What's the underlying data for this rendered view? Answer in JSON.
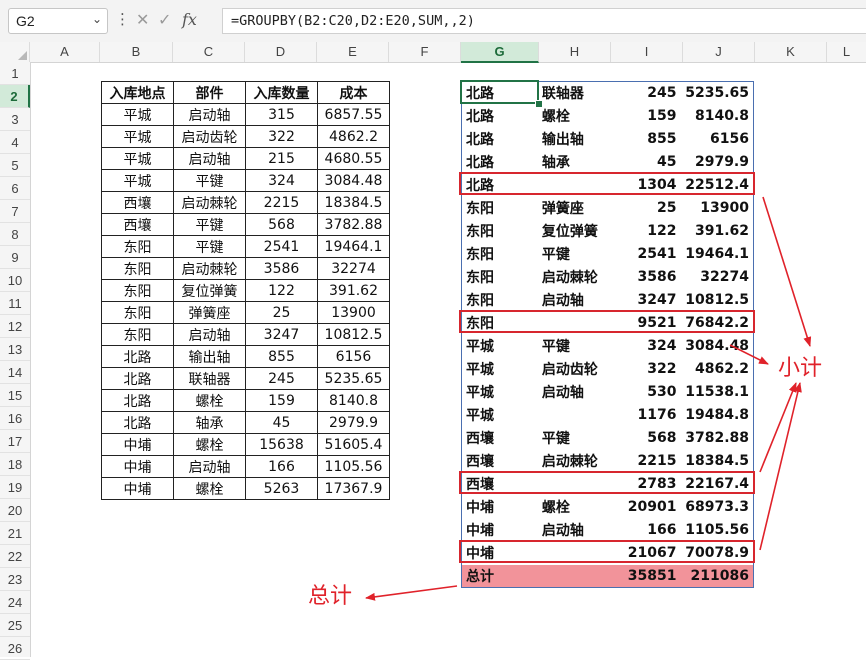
{
  "formula_bar": {
    "name_box": "G2",
    "fx_label": "fx",
    "formula": "=GROUPBY(B2:C20,D2:E20,SUM,,2)"
  },
  "columns": [
    "A",
    "B",
    "C",
    "D",
    "E",
    "F",
    "G",
    "H",
    "I",
    "J",
    "K",
    "L"
  ],
  "rows": [
    "1",
    "2",
    "3",
    "4",
    "5",
    "6",
    "7",
    "8",
    "9",
    "10",
    "11",
    "12",
    "13",
    "14",
    "15",
    "16",
    "17",
    "18",
    "19",
    "20",
    "21",
    "22",
    "23",
    "24",
    "25",
    "26"
  ],
  "left_table": {
    "headers": [
      "入库地点",
      "部件",
      "入库数量",
      "成本"
    ],
    "rows": [
      [
        "平城",
        "启动轴",
        "315",
        "6857.55"
      ],
      [
        "平城",
        "启动齿轮",
        "322",
        "4862.2"
      ],
      [
        "平城",
        "启动轴",
        "215",
        "4680.55"
      ],
      [
        "平城",
        "平键",
        "324",
        "3084.48"
      ],
      [
        "西壤",
        "启动棘轮",
        "2215",
        "18384.5"
      ],
      [
        "西壤",
        "平键",
        "568",
        "3782.88"
      ],
      [
        "东阳",
        "平键",
        "2541",
        "19464.1"
      ],
      [
        "东阳",
        "启动棘轮",
        "3586",
        "32274"
      ],
      [
        "东阳",
        "复位弹簧",
        "122",
        "391.62"
      ],
      [
        "东阳",
        "弹簧座",
        "25",
        "13900"
      ],
      [
        "东阳",
        "启动轴",
        "3247",
        "10812.5"
      ],
      [
        "北路",
        "输出轴",
        "855",
        "6156"
      ],
      [
        "北路",
        "联轴器",
        "245",
        "5235.65"
      ],
      [
        "北路",
        "螺栓",
        "159",
        "8140.8"
      ],
      [
        "北路",
        "轴承",
        "45",
        "2979.9"
      ],
      [
        "中埔",
        "螺栓",
        "15638",
        "51605.4"
      ],
      [
        "中埔",
        "启动轴",
        "166",
        "1105.56"
      ],
      [
        "中埔",
        "螺栓",
        "5263",
        "17367.9"
      ]
    ]
  },
  "right_table": {
    "rows": [
      [
        "北路",
        "联轴器",
        "245",
        "5235.65"
      ],
      [
        "北路",
        "螺栓",
        "159",
        "8140.8"
      ],
      [
        "北路",
        "输出轴",
        "855",
        "6156"
      ],
      [
        "北路",
        "轴承",
        "45",
        "2979.9"
      ],
      [
        "北路",
        "",
        "1304",
        "22512.4"
      ],
      [
        "东阳",
        "弹簧座",
        "25",
        "13900"
      ],
      [
        "东阳",
        "复位弹簧",
        "122",
        "391.62"
      ],
      [
        "东阳",
        "平键",
        "2541",
        "19464.1"
      ],
      [
        "东阳",
        "启动棘轮",
        "3586",
        "32274"
      ],
      [
        "东阳",
        "启动轴",
        "3247",
        "10812.5"
      ],
      [
        "东阳",
        "",
        "9521",
        "76842.2"
      ],
      [
        "平城",
        "平键",
        "324",
        "3084.48"
      ],
      [
        "平城",
        "启动齿轮",
        "322",
        "4862.2"
      ],
      [
        "平城",
        "启动轴",
        "530",
        "11538.1"
      ],
      [
        "平城",
        "",
        "1176",
        "19484.8"
      ],
      [
        "西壤",
        "平键",
        "568",
        "3782.88"
      ],
      [
        "西壤",
        "启动棘轮",
        "2215",
        "18384.5"
      ],
      [
        "西壤",
        "",
        "2783",
        "22167.4"
      ],
      [
        "中埔",
        "螺栓",
        "20901",
        "68973.3"
      ],
      [
        "中埔",
        "启动轴",
        "166",
        "1105.56"
      ],
      [
        "中埔",
        "",
        "21067",
        "70078.9"
      ],
      [
        "总计",
        "",
        "35851",
        "211086"
      ]
    ]
  },
  "annotations": {
    "subtotal": "小计",
    "grand_total": "总计"
  },
  "colors": {
    "accent": "#217346",
    "highlight_box": "#d7262e",
    "total_row": "#f2939a",
    "annotation": "#e0222a"
  }
}
